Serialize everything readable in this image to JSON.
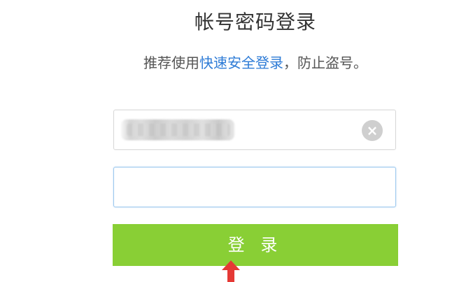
{
  "header": {
    "title": "帐号密码登录"
  },
  "subtitle": {
    "prefix": "推荐使用",
    "link_text": "快速安全登录",
    "suffix": "，防止盗号。"
  },
  "username_field": {
    "value": "",
    "clear_icon": "close-circle-icon"
  },
  "password_field": {
    "value": "",
    "placeholder": ""
  },
  "login_button": {
    "label": "登 录",
    "background_color": "#89cf35",
    "text_color": "#ffffff"
  },
  "annotation": {
    "arrow_color": "#e53935",
    "icon": "red-arrow-up-icon"
  }
}
